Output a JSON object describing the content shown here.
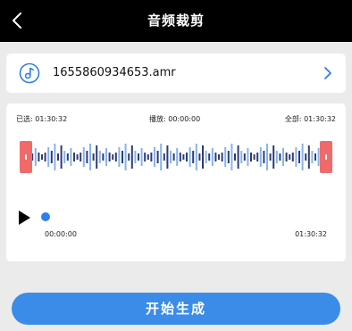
{
  "header": {
    "title": "音频裁剪",
    "back_icon": "chevron-left-icon"
  },
  "file": {
    "name": "1655860934653.amr",
    "icon": "music-note-icon",
    "chevron_icon": "chevron-right-icon"
  },
  "editor": {
    "selected_label": "已选: 01:30:32",
    "playing_label": "播放: 00:00:00",
    "total_label": "全部: 01:30:32",
    "start_time": "00:00:00",
    "end_time": "01:30:32",
    "selection_start_fraction": 0,
    "selection_end_fraction": 1,
    "playback_fraction": 0
  },
  "colors": {
    "accent": "#2f7fea",
    "button": "#3b8ce8",
    "handle": "#f06a6a",
    "wave_dark": "#2e3b73",
    "wave_light": "#86b4ee"
  },
  "actions": {
    "generate_label": "开始生成"
  }
}
